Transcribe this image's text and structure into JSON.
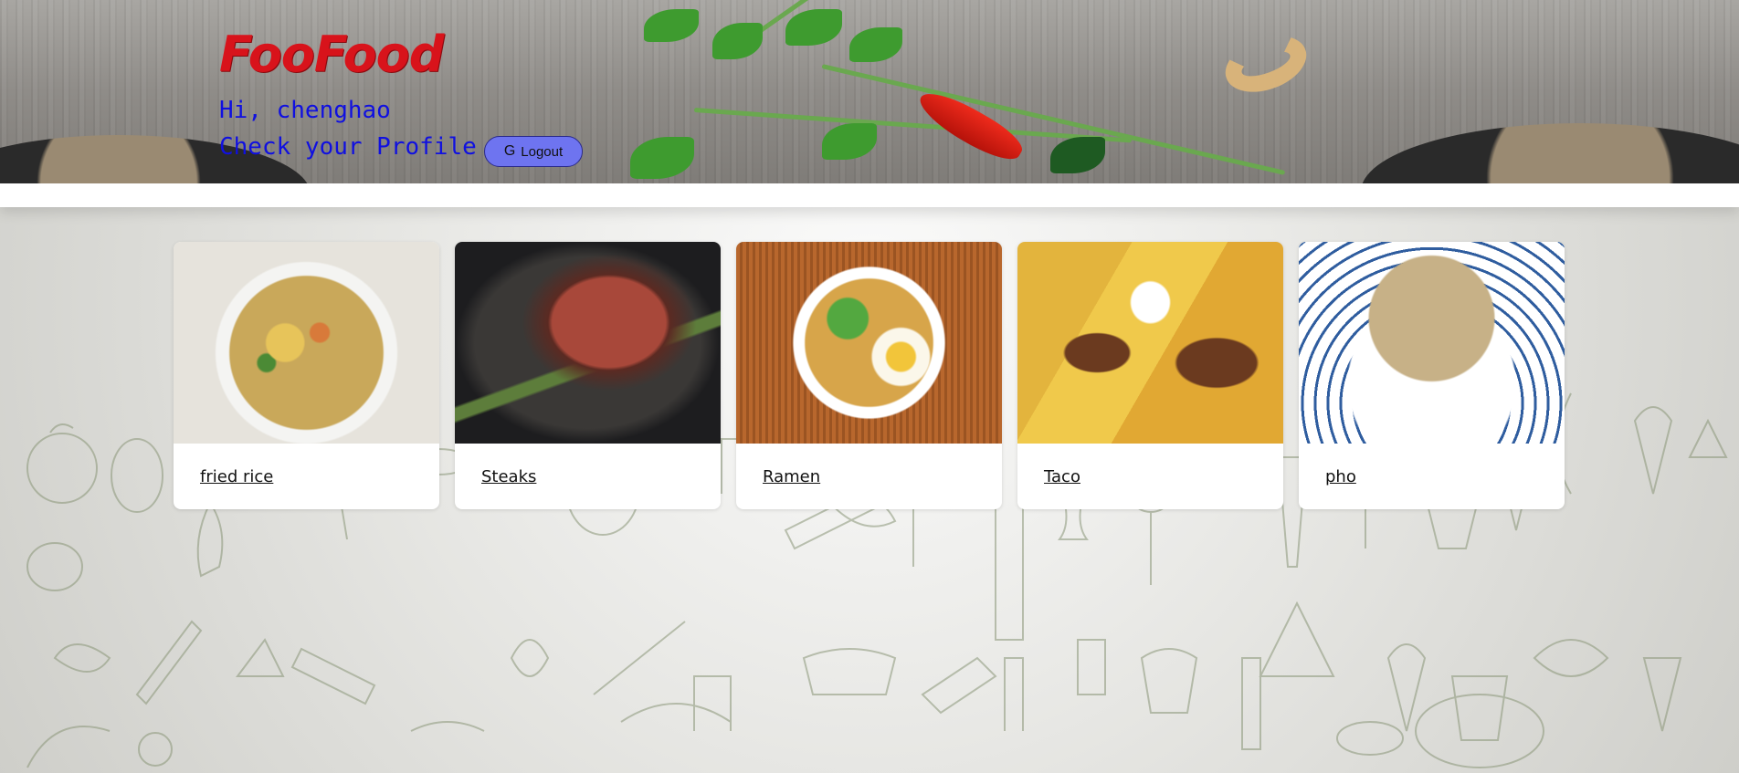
{
  "header": {
    "brand": "FooFood",
    "greeting": "Hi, chenghao",
    "profile_link": "Check your Profile",
    "logout_label": "Logout",
    "logout_icon": "G"
  },
  "cards": [
    {
      "title": "fried rice",
      "image": "fried-rice-image"
    },
    {
      "title": "Steaks",
      "image": "steak-image"
    },
    {
      "title": "Ramen",
      "image": "ramen-image"
    },
    {
      "title": "Taco",
      "image": "taco-image"
    },
    {
      "title": "pho",
      "image": "pho-image"
    }
  ],
  "colors": {
    "brand": "#d8131b",
    "link": "#1010e0",
    "logout_bg": "#6e74f0"
  }
}
